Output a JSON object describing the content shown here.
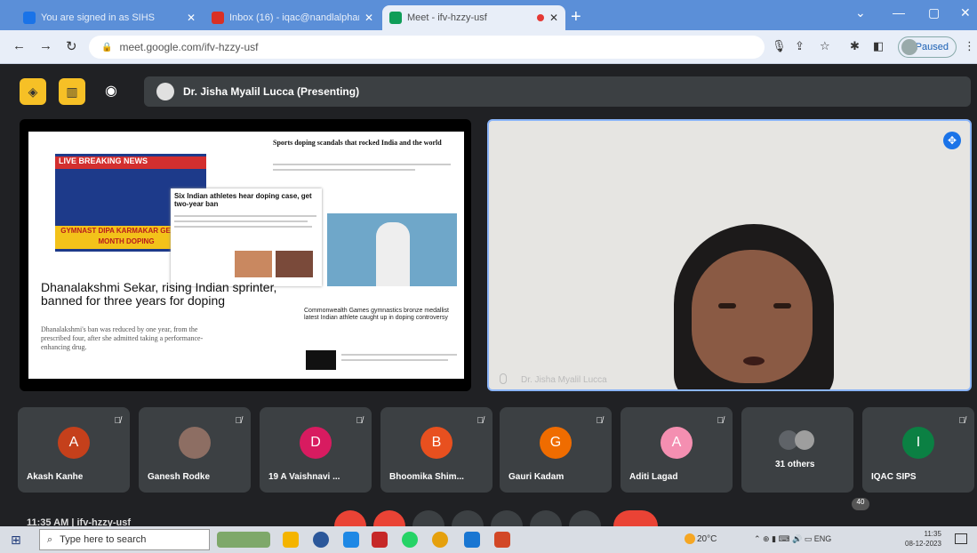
{
  "browser": {
    "tabs": [
      {
        "title": "You are signed in as SIHS",
        "favicon_color": "#1a73e8"
      },
      {
        "title": "Inbox (16) - iqac@nandlalpharma...",
        "favicon_color": "#d93025"
      },
      {
        "title": "Meet - ifv-hzzy-usf",
        "favicon_color": "#0f9d58",
        "recording": true
      }
    ],
    "url": "meet.google.com/ifv-hzzy-usf",
    "profile_label": "Paused"
  },
  "meet": {
    "presenter_label": "Dr. Jisha Myalil Lucca (Presenting)",
    "camera_name": "Dr. Jisha Myalil Lucca",
    "meeting_code": "ifv-hzzy-usf",
    "time": "11:35 AM",
    "slide": {
      "breaking_label": "LIVE BREAKING NEWS",
      "ticker": "GYMNAST DIPA KARMAKAR GETS 21-MONTH DOPING",
      "top_article": "Sports doping scandals that rocked India and the world",
      "card_headline": "Six Indian athletes hear doping case, get two-year ban",
      "main_headline": "Dhanalakshmi Sekar, rising Indian sprinter, banned for three years for doping",
      "main_body": "Dhanalakshmi's ban was reduced by one year, from the prescribed four, after she admitted taking a performance-enhancing drug.",
      "side_article": "Commonwealth Games gymnastics bronze medallist latest Indian athlete caught up in doping controversy"
    },
    "participants": [
      {
        "initial": "A",
        "name": "Akash Kanhe",
        "color": "#c5401b"
      },
      {
        "initial": "",
        "name": "Ganesh Rodke",
        "color": "#8d6e63"
      },
      {
        "initial": "D",
        "name": "19 A Vaishnavi ...",
        "color": "#d81b60"
      },
      {
        "initial": "B",
        "name": "Bhoomika Shim...",
        "color": "#e8501f"
      },
      {
        "initial": "G",
        "name": "Gauri Kadam",
        "color": "#ef6c00"
      },
      {
        "initial": "A",
        "name": "Aditi Lagad",
        "color": "#f48fb1"
      },
      {
        "initial": "",
        "name": "31 others",
        "color": "#5f6368"
      },
      {
        "initial": "I",
        "name": "IQAC SIPS",
        "color": "#0b8043"
      }
    ],
    "people_badge": "40"
  },
  "taskbar": {
    "search_placeholder": "Type here to search",
    "weather": "20°C",
    "lang": "ENG",
    "clock_time": "11:35",
    "clock_date": "08-12-2023"
  }
}
